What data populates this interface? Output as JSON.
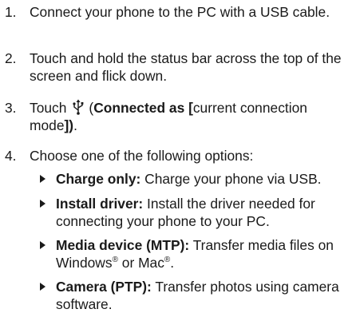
{
  "steps": [
    {
      "num": "1.",
      "text": "Connect your phone to the PC with a USB cable."
    },
    {
      "num": "2.",
      "text": "Touch and hold the status bar across the top of the screen and flick down."
    },
    {
      "num": "3.",
      "prefix": "Touch",
      "open_paren": "(",
      "bold": "Connected as [",
      "normal": "current connection mode",
      "bold_end": "])",
      "end": ".",
      "icon": "usb-icon"
    },
    {
      "num": "4.",
      "text": "Choose one of the following options:"
    }
  ],
  "options": [
    {
      "label": "Charge only:",
      "text": " Charge your phone via USB."
    },
    {
      "label": "Install driver:",
      "text": " Install the driver needed for connecting your phone to your PC."
    },
    {
      "label": "Media device (MTP):",
      "text_a": " Transfer media files on Windows",
      "reg1": "®",
      "text_b": " or Mac",
      "reg2": "®",
      "text_c": "."
    },
    {
      "label": "Camera (PTP):",
      "text": " Transfer photos using camera software."
    }
  ]
}
